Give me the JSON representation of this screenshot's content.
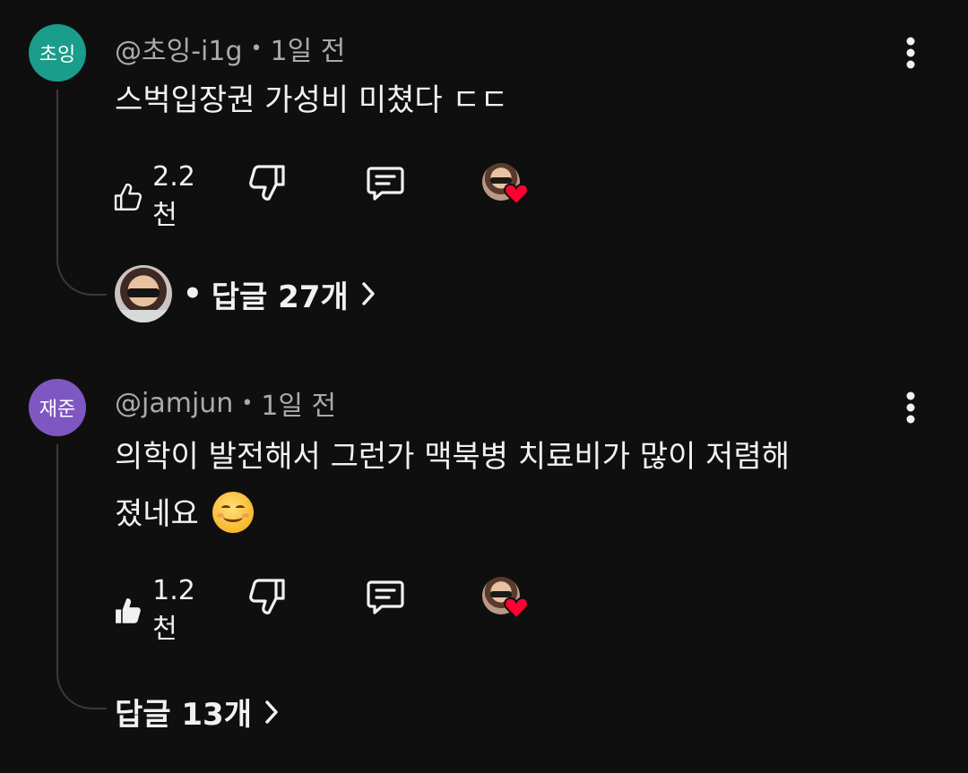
{
  "comments": [
    {
      "avatar_text": "초잉",
      "avatar_color": "#1a9d8b",
      "handle": "@초잉-i1g",
      "time": "1일 전",
      "text_lines": [
        "스벅입장권 가성비 미쳤다 ㄷㄷ"
      ],
      "likes": "2.2천",
      "liked": false,
      "replies_label": "답글 27개"
    },
    {
      "avatar_text": "재준",
      "avatar_color": "#7e57c2",
      "handle": "@jamjun",
      "time": "1일 전",
      "text_lines": [
        "의학이 발전해서 그런가 맥북병 치료비가 많이 저렴해",
        "졌네요"
      ],
      "likes": "1.2천",
      "liked": true,
      "replies_label": "답글 13개"
    }
  ],
  "colors": {
    "heart": "#ff0033",
    "muted_text": "#aaaaaa",
    "background": "#0f0f0f"
  },
  "icons": [
    "like-icon",
    "dislike-icon",
    "reply-icon",
    "creator-heart-icon",
    "more-vert-icon",
    "chevron-right-icon",
    "smiling-face-emoji"
  ]
}
